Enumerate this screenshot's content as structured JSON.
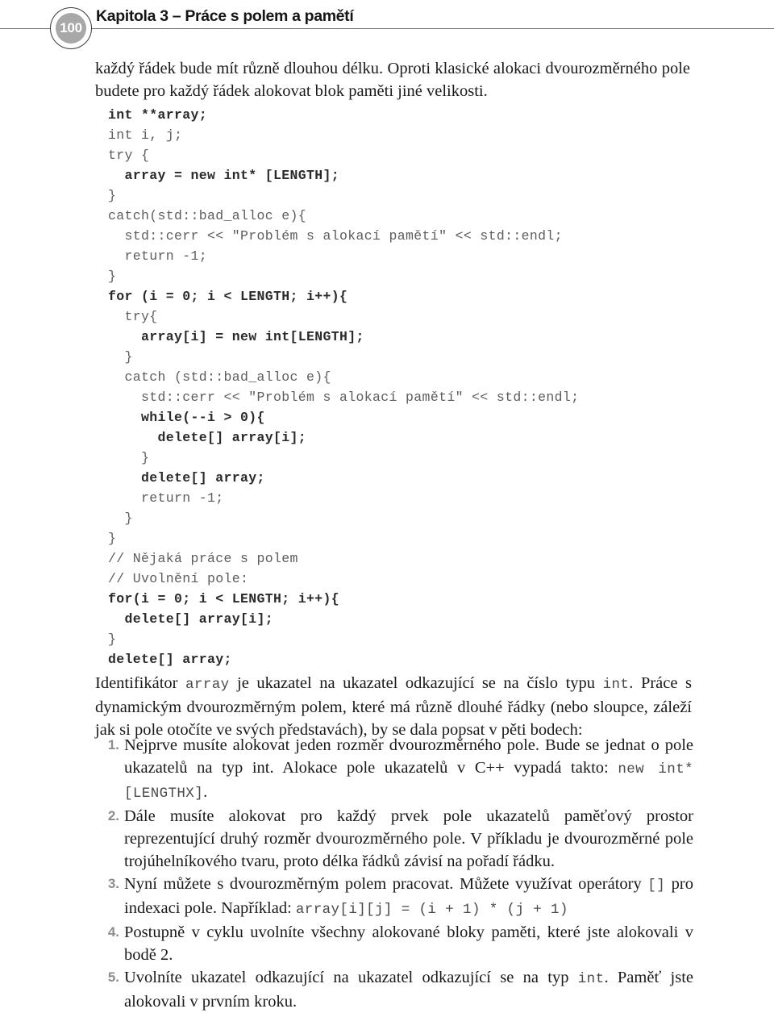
{
  "header": {
    "page_number": "100",
    "title": "Kapitola 3 – Práce s polem a pamětí"
  },
  "intro_paragraph": "každý řádek bude mít různě dlouhou délku. Oproti klasické alokaci dvourozměrného pole budete pro každý řádek alokovat blok paměti jiné velikosti.",
  "code": {
    "lines": [
      {
        "text": "int **array;",
        "emphasis": true
      },
      {
        "text": "int i, j;",
        "emphasis": false
      },
      {
        "text": "try {",
        "emphasis": false
      },
      {
        "text": "  array = new int* [LENGTH];",
        "emphasis": true
      },
      {
        "text": "}",
        "emphasis": false
      },
      {
        "text": "catch(std::bad_alloc e){",
        "emphasis": false
      },
      {
        "text": "  std::cerr << \"Problém s alokací pamětí\" << std::endl;",
        "emphasis": false
      },
      {
        "text": "  return -1;",
        "emphasis": false
      },
      {
        "text": "}",
        "emphasis": false
      },
      {
        "text": "for (i = 0; i < LENGTH; i++){",
        "emphasis": true
      },
      {
        "text": "  try{",
        "emphasis": false
      },
      {
        "text": "    array[i] = new int[LENGTH];",
        "emphasis": true
      },
      {
        "text": "  }",
        "emphasis": false
      },
      {
        "text": "  catch (std::bad_alloc e){",
        "emphasis": false
      },
      {
        "text": "    std::cerr << \"Problém s alokací pamětí\" << std::endl;",
        "emphasis": false
      },
      {
        "text": "    while(--i > 0){",
        "emphasis": true
      },
      {
        "text": "      delete[] array[i];",
        "emphasis": true
      },
      {
        "text": "    }",
        "emphasis": false
      },
      {
        "text": "    delete[] array;",
        "emphasis": true
      },
      {
        "text": "    return -1;",
        "emphasis": false
      },
      {
        "text": "  }",
        "emphasis": false
      },
      {
        "text": "}",
        "emphasis": false
      },
      {
        "text": "// Nějaká práce s polem",
        "emphasis": false
      },
      {
        "text": "// Uvolnění pole:",
        "emphasis": false
      },
      {
        "text": "for(i = 0; i < LENGTH; i++){",
        "emphasis": true
      },
      {
        "text": "  delete[] array[i];",
        "emphasis": true
      },
      {
        "text": "}",
        "emphasis": false
      },
      {
        "text": "delete[] array;",
        "emphasis": true
      }
    ]
  },
  "identifier_paragraph": {
    "seg1": "Identifikátor ",
    "code1": "array",
    "seg2": " je ukazatel na ukazatel odkazující se na číslo typu ",
    "code2": "int",
    "seg3": ". Práce s dynamickým dvourozměrným polem, které má různě dlouhé řádky (nebo sloupce, záleží jak si pole otočíte ve svých představách), by se dala popsat v pěti bodech:"
  },
  "steps": [
    {
      "number": "1.",
      "seg1": "Nejprve musíte alokovat jeden rozměr dvourozměrného pole. Bude se jednat o pole ukazatelů na typ int. Alokace pole ukazatelů v C++ vypadá takto: ",
      "code1": "new int* [LENGTHX]",
      "seg2": "."
    },
    {
      "number": "2.",
      "seg1": "Dále musíte alokovat pro každý prvek pole ukazatelů paměťový prostor reprezentující druhý rozměr dvourozměrného pole. V příkladu je dvourozměrné pole trojúhelníkového tvaru, proto délka řádků závisí na pořadí řádku.",
      "code1": "",
      "seg2": ""
    },
    {
      "number": "3.",
      "seg1": "Nyní můžete s dvourozměrným polem pracovat. Můžete využívat operátory ",
      "code1": "[]",
      "seg2": "  pro indexaci pole. Například: ",
      "code2": "array[i][j] = (i + 1) * (j + 1)"
    },
    {
      "number": "4.",
      "seg1": "Postupně v cyklu uvolníte všechny alokované bloky paměti, které jste alokovali v bodě 2.",
      "code1": "",
      "seg2": ""
    },
    {
      "number": "5.",
      "seg1": "Uvolníte ukazatel odkazující na ukazatel odkazující se na typ ",
      "code1": "int",
      "seg2": ". Paměť jste alokovali v prvním kroku."
    }
  ],
  "colors": {
    "rule": "#6e6e6e",
    "folio_fill": "#a8a8a8",
    "code_text": "#5d5d5d",
    "code_emphasis": "#2a2a2a",
    "step_number": "#8d8d8d"
  }
}
